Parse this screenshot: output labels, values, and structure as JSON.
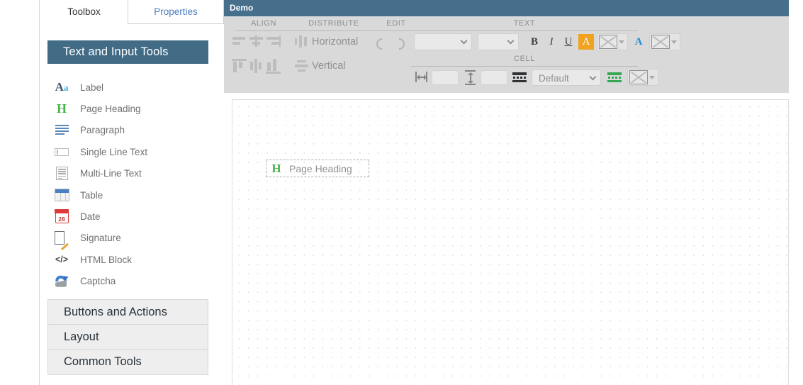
{
  "tabs": [
    {
      "label": "Toolbox",
      "active": true
    },
    {
      "label": "Properties",
      "active": false
    }
  ],
  "toolbox": {
    "group_title": "Text and Input Tools",
    "tools": [
      {
        "label": "Label",
        "icon": "label-aa-icon"
      },
      {
        "label": "Page Heading",
        "icon": "page-heading-h-icon"
      },
      {
        "label": "Paragraph",
        "icon": "paragraph-lines-icon"
      },
      {
        "label": "Single Line Text",
        "icon": "single-line-text-icon"
      },
      {
        "label": "Multi-Line Text",
        "icon": "multi-line-text-icon"
      },
      {
        "label": "Table",
        "icon": "table-icon"
      },
      {
        "label": "Date",
        "icon": "date-calendar-icon"
      },
      {
        "label": "Signature",
        "icon": "signature-pen-icon"
      },
      {
        "label": "HTML Block",
        "icon": "html-code-icon"
      },
      {
        "label": "Captcha",
        "icon": "captcha-refresh-icon"
      }
    ],
    "collapsed_sections": [
      {
        "label": "Buttons and Actions"
      },
      {
        "label": "Layout"
      },
      {
        "label": "Common Tools"
      }
    ]
  },
  "window": {
    "title": "Demo"
  },
  "toolbar": {
    "groups": {
      "align": "ALIGN",
      "distribute": "DISTRIBUTE",
      "edit": "EDIT",
      "text": "TEXT",
      "cell": "CELL"
    },
    "align_buttons": [
      {
        "name": "align-left-icon"
      },
      {
        "name": "align-center-horizontal-icon"
      },
      {
        "name": "align-right-icon"
      },
      {
        "name": "align-top-icon"
      },
      {
        "name": "align-middle-vertical-icon"
      },
      {
        "name": "align-bottom-icon"
      }
    ],
    "distribute": {
      "horizontal_label": "Horizontal",
      "vertical_label": "Vertical"
    },
    "edit": {
      "undo": "undo-icon",
      "redo": "redo-icon"
    },
    "text": {
      "font_family_value": "",
      "font_size_value": "",
      "bold_label": "B",
      "italic_label": "I",
      "underline_label": "U",
      "highlight_label": "A",
      "font_color_label": "A",
      "highlight_color_swatch": "broken-image-swatch",
      "font_color_swatch": "broken-image-swatch"
    },
    "cell": {
      "width_value": "",
      "height_value": "",
      "border_style_value": "Default",
      "width_icon": "cell-width-icon",
      "height_icon": "cell-height-icon",
      "border_icon": "cell-border-black-icon",
      "fill_icon": "cell-border-green-icon",
      "fill_swatch": "broken-image-swatch"
    }
  },
  "canvas": {
    "widget": {
      "icon_label": "H",
      "label": "Page Heading"
    }
  },
  "colors": {
    "titlebar": "#466f8c",
    "group_header": "#426b86",
    "toolbar_bg": "#d9d9d9",
    "tab_link": "#4b7ec1",
    "highlight_orange": "#efa320",
    "font_color_blue": "#1a8fd0",
    "green_accent": "#46b24a"
  }
}
